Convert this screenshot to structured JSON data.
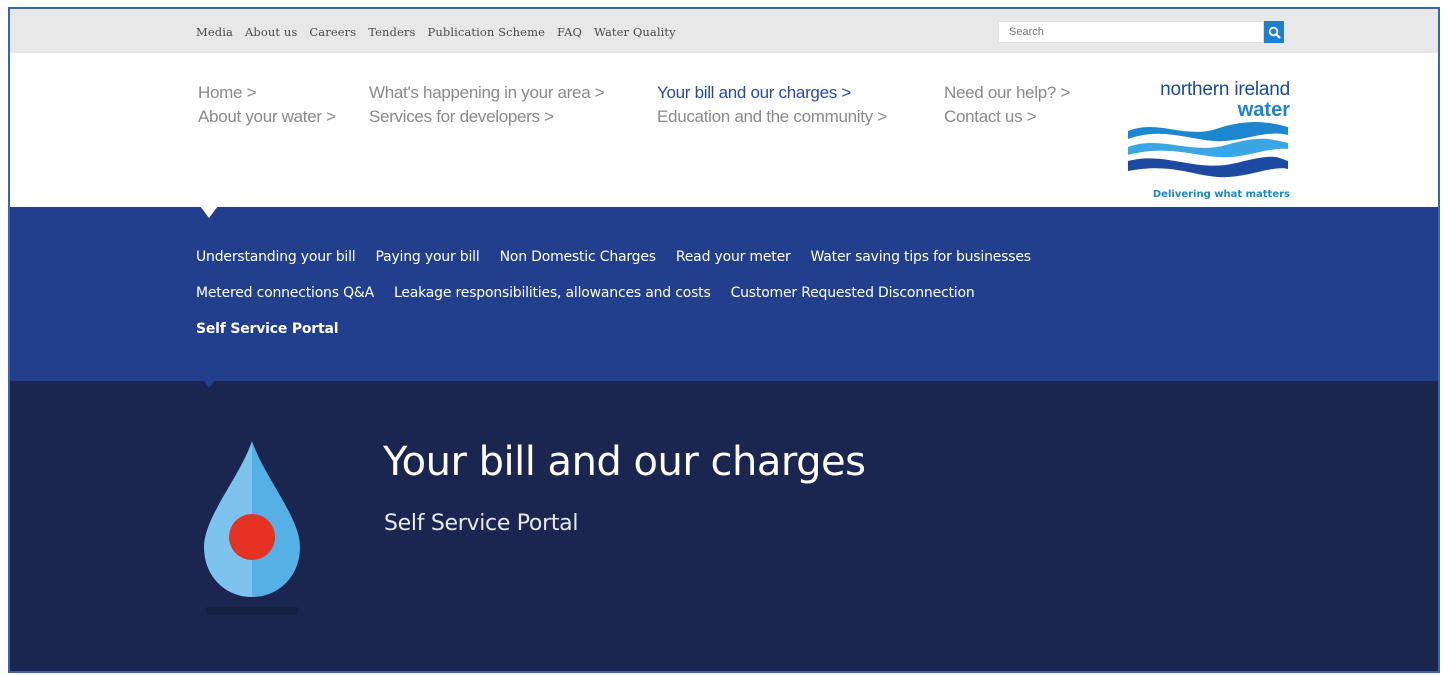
{
  "utility": {
    "links": [
      "Media",
      "About us",
      "Careers",
      "Tenders",
      "Publication Scheme",
      "FAQ",
      "Water Quality"
    ],
    "search_placeholder": "Search"
  },
  "main_nav": {
    "col1": [
      "Home >",
      "About your water >"
    ],
    "col2": [
      "What's happening in your area >",
      "Services for developers >"
    ],
    "col3": [
      "Your bill and our charges >",
      "Education and the community >"
    ],
    "col4": [
      "Need our help? >",
      "Contact us >"
    ]
  },
  "logo": {
    "line1": "northern ireland",
    "line2": "water",
    "tagline": "Delivering what matters"
  },
  "sub_nav": {
    "row1": [
      "Understanding your bill",
      "Paying your bill",
      "Non Domestic Charges",
      "Read your meter",
      "Water saving tips for businesses"
    ],
    "row2": [
      "Metered connections Q&A",
      "Leakage responsibilities, allowances and costs",
      "Customer Requested Disconnection"
    ],
    "row3": [
      "Self Service Portal"
    ]
  },
  "hero": {
    "title": "Your bill and our charges",
    "subtitle": "Self Service Portal"
  },
  "colors": {
    "sub_nav_bg": "#223f8e",
    "hero_bg": "#1a2650",
    "accent_blue": "#1d86d0",
    "brand_navy": "#1c4aa0",
    "drop_light": "#7cc4ee",
    "drop_red": "#e53222"
  },
  "icons": [
    "search-icon",
    "water-drop-icon"
  ]
}
